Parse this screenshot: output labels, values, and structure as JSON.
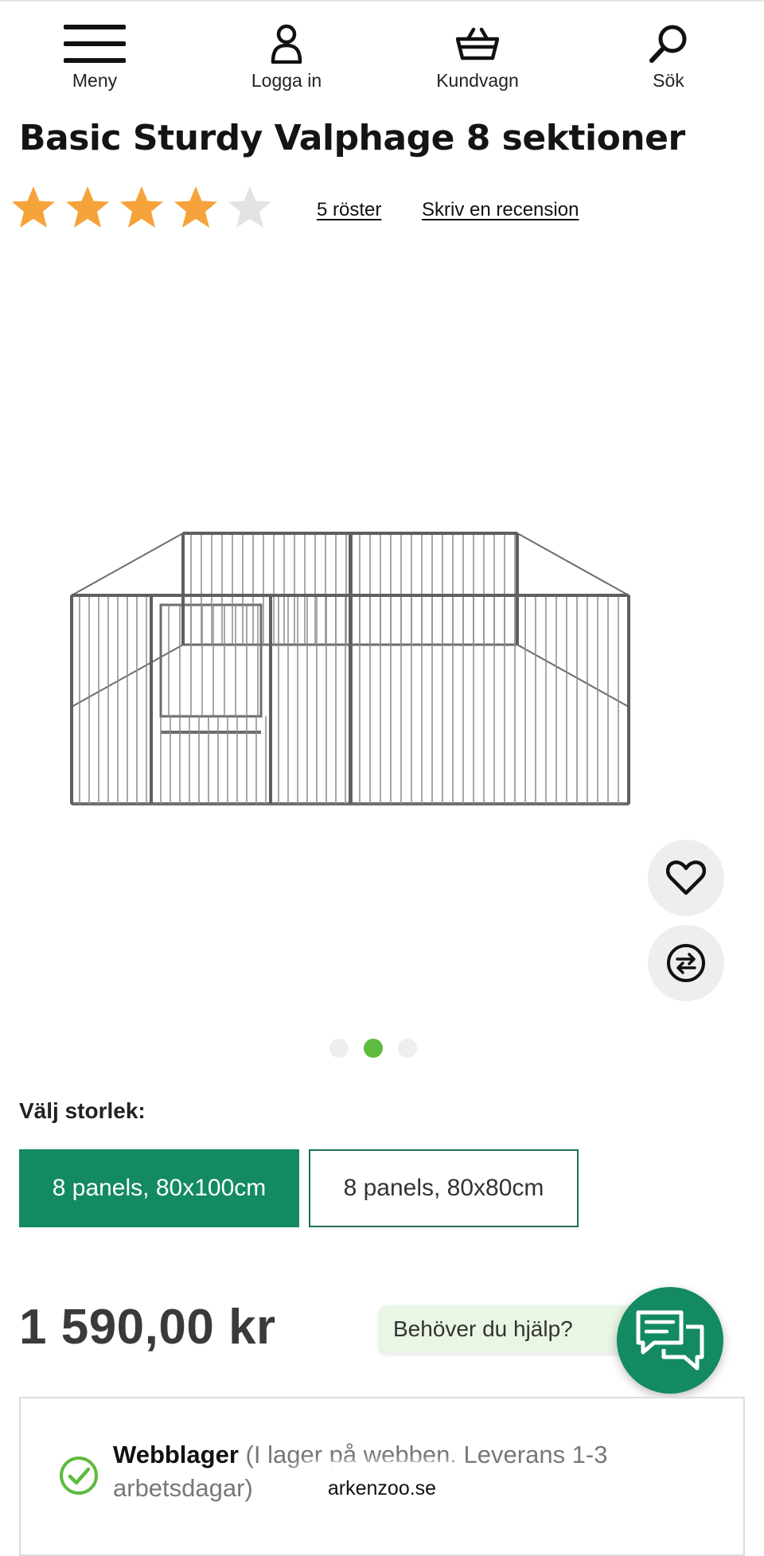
{
  "nav": {
    "menu_label": "Meny",
    "login_label": "Logga in",
    "cart_label": "Kundvagn",
    "search_label": "Sök"
  },
  "product": {
    "title": "Basic Sturdy Valphage 8 sektioner",
    "rating": {
      "stars_filled": 4,
      "stars_total": 5,
      "votes_label": "5 röster",
      "review_link_label": "Skriv en recension"
    },
    "image_alt_icon": "pet-playpen-image",
    "carousel": {
      "total": 3,
      "active_index": 1
    },
    "size": {
      "label": "Välj storlek:",
      "options": [
        {
          "label": "8 panels, 80x100cm",
          "selected": true
        },
        {
          "label": "8 panels, 80x80cm",
          "selected": false
        }
      ]
    },
    "price": "1 590,00 kr",
    "stock": {
      "title": "Webblager",
      "detail": "(I lager på webben. Leverans 1-3 arbetsdagar)"
    }
  },
  "help": {
    "label": "Behöver du hjälp?"
  },
  "browser": {
    "domain": "arkenzoo.se"
  },
  "colors": {
    "brand_green": "#138a63",
    "star_filled": "#f5a33a",
    "star_empty": "#e3e3e3",
    "dot_active": "#5dbb3f",
    "help_bg": "#e9f6e4"
  }
}
